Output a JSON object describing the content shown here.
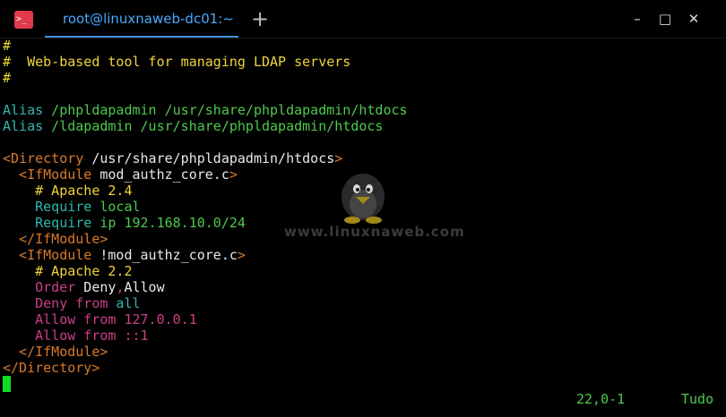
{
  "tab": {
    "title": "root@linuxnaweb-dc01:~"
  },
  "toolbar": {
    "new_tab": "+",
    "minimize": "–",
    "maximize": "□",
    "close": "✕"
  },
  "app_icon": ">_",
  "editor": {
    "lines": [
      [
        "#"
      ],
      [
        "#  Web-based tool for managing LDAP servers"
      ],
      [
        "#"
      ],
      [
        ""
      ],
      [
        "Alias",
        " /phpldapadmin /usr/share/phpldapadmin/htdocs"
      ],
      [
        "Alias",
        " /ldapadmin /usr/share/phpldapadmin/htdocs"
      ],
      [
        ""
      ],
      [
        "<Directory",
        " /usr/share/phpldapadmin/htdocs",
        ">"
      ],
      [
        "  <IfModule",
        " mod_authz_core.c",
        ">"
      ],
      [
        "    # Apache 2.4"
      ],
      [
        "    Require",
        " local"
      ],
      [
        "    Require",
        " ip 192.168.10.0/24"
      ],
      [
        "  </IfModule>"
      ],
      [
        "  <IfModule",
        " !mod_authz_core.c",
        ">"
      ],
      [
        "    # Apache 2.2"
      ],
      [
        "    Order",
        " Deny",
        ",",
        "Allow"
      ],
      [
        "    Deny",
        " from",
        " all"
      ],
      [
        "    Allow",
        " from",
        " 127.0.0.1"
      ],
      [
        "    Allow",
        " from",
        " ::1"
      ],
      [
        "  </IfModule>"
      ],
      [
        "</Directory>"
      ]
    ]
  },
  "status": {
    "position": "22,0-1",
    "scroll": "Tudo"
  },
  "watermark": {
    "text": "www.linuxnaweb.com"
  },
  "colors": {
    "comment": "#f0d43a",
    "keyword": "#2fb7b0",
    "value": "#4ec94e",
    "tag": "#d97a2b",
    "plain": "#e8e8e8",
    "directive": "#cc3f86",
    "tab_accent": "#3d8fe0",
    "cursor": "#11dd22"
  }
}
